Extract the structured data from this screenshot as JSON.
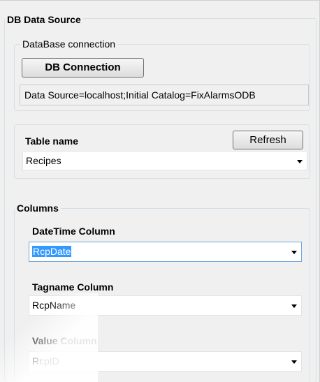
{
  "db_data_source": {
    "title": "DB Data Source",
    "connection_group": {
      "title": "DataBase connection",
      "button_label": "DB Connection",
      "connection_string": "Data Source=localhost;Initial Catalog=FixAlarmsODB"
    },
    "table_group": {
      "label": "Table name",
      "refresh_label": "Refresh",
      "selected": "Recipes"
    },
    "columns_group": {
      "title": "Columns",
      "datetime": {
        "label": "DateTime Column",
        "value": "RcpDate"
      },
      "tagname": {
        "label": "Tagname Column",
        "value": "RcpName"
      },
      "value": {
        "label": "Value Column",
        "value": "RcpID"
      }
    }
  }
}
